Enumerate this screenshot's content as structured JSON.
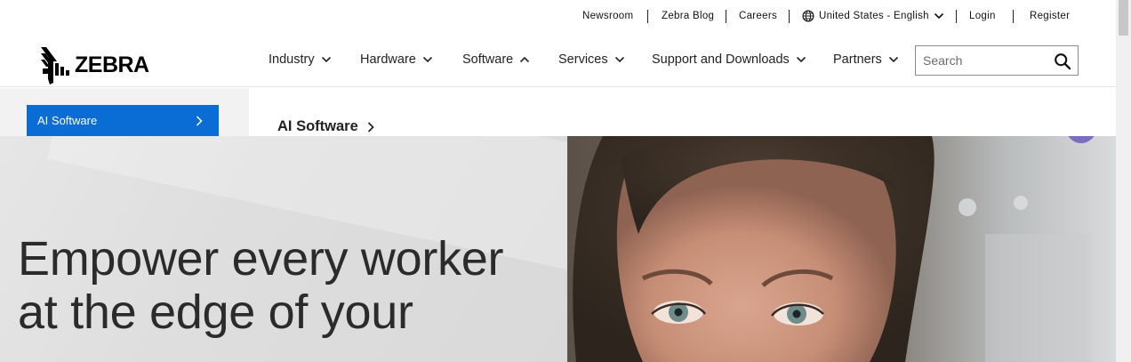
{
  "utility": {
    "newsroom": "Newsroom",
    "blog": "Zebra Blog",
    "careers": "Careers",
    "region": "United States - English",
    "login": "Login",
    "register": "Register"
  },
  "brand": {
    "name": "ZEBRA"
  },
  "nav": {
    "industry": "Industry",
    "hardware": "Hardware",
    "software": "Software",
    "services": "Services",
    "support": "Support and Downloads",
    "partners": "Partners"
  },
  "search": {
    "placeholder": "Search"
  },
  "subnav": {
    "button_label": "AI Software",
    "heading": "AI Software"
  },
  "hero": {
    "title": "Empower every worker at the edge of your"
  },
  "colors": {
    "accent_blue": "#0a6dd6",
    "hero_bg": "#e2e2e2",
    "accent_purple": "#7c6cc4"
  },
  "icons": [
    "globe-icon",
    "chevron-down-icon",
    "chevron-up-icon",
    "search-icon",
    "chevron-right-icon",
    "zebra-logo-icon"
  ]
}
